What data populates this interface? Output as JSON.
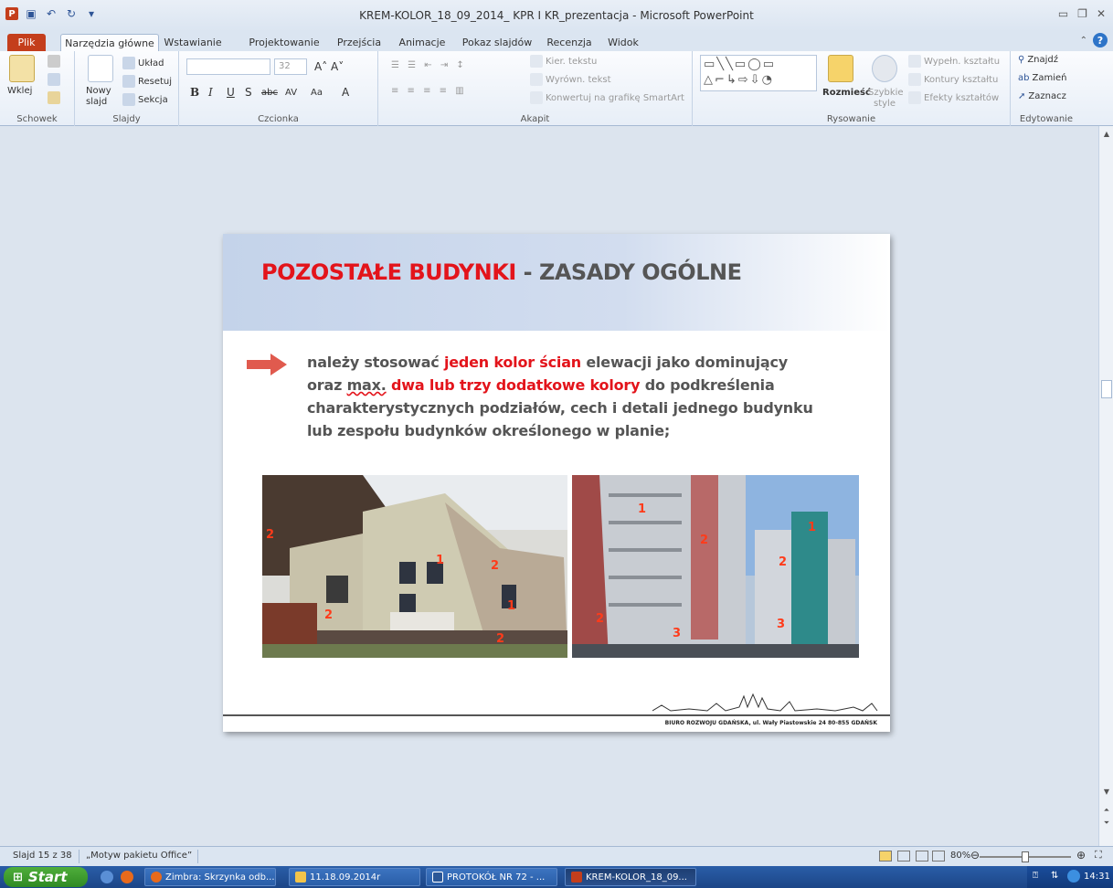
{
  "window": {
    "title": "KREM-KOLOR_18_09_2014_ KPR I KR_prezentacja  -  Microsoft PowerPoint"
  },
  "tabs": [
    "Plik",
    "Narzędzia główne",
    "Wstawianie",
    "Projektowanie",
    "Przejścia",
    "Animacje",
    "Pokaz slajdów",
    "Recenzja",
    "Widok"
  ],
  "ribbon": {
    "schowek": {
      "label": "Schowek",
      "paste": "Wklej"
    },
    "slajdy": {
      "label": "Slajdy",
      "new_slide_1": "Nowy",
      "new_slide_2": "slajd",
      "layout": "Układ",
      "reset": "Resetuj",
      "section": "Sekcja"
    },
    "czcionka": {
      "label": "Czcionka",
      "size": "32",
      "bold": "B",
      "italic": "I",
      "underline": "U",
      "shadow": "S",
      "strike": "abc",
      "spacing": "AV",
      "case": "Aa",
      "color": "A"
    },
    "akapit": {
      "label": "Akapit",
      "text_dir": "Kier. tekstu",
      "align_text": "Wyrówn. tekst",
      "smartart": "Konwertuj na grafikę SmartArt"
    },
    "rysowanie": {
      "label": "Rysowanie",
      "arrange": "Rozmieść",
      "quick_styles_1": "Szybkie",
      "quick_styles_2": "style",
      "fill": "Wypełn. kształtu",
      "outline": "Kontury kształtu",
      "effects": "Efekty kształtów"
    },
    "edytowanie": {
      "label": "Edytowanie",
      "find": "Znajdź",
      "replace": "Zamień",
      "select": "Zaznacz"
    }
  },
  "slide": {
    "title_red": "POZOSTAŁE BUDYNKI",
    "title_gray": " - ZASADY OGÓLNE",
    "bullet": {
      "p1": "należy stosować ",
      "r1": "jeden kolor ścian",
      "p2": " elewacji jako dominujący",
      "p3": "oraz ",
      "u1": "max.",
      "p4": " ",
      "r2": "dwa lub trzy dodatkowe kolory",
      "p5": " do podkreślenia",
      "p6": "charakterystycznych podziałów, cech i detali jednego budynku",
      "p7": "lub zespołu budynków określonego w planie;"
    },
    "badges": [
      "2",
      "1",
      "2",
      "2",
      "1",
      "2",
      "1",
      "2",
      "2",
      "1",
      "2",
      "3",
      "3"
    ],
    "footer": "BIURO ROZWOJU GDAŃSKA, ul. Wały Piastowskie 24  80-855 GDAŃSK"
  },
  "status": {
    "slide": "Slajd 15 z 38",
    "theme": "„Motyw pakietu Office”",
    "zoom": "80%",
    "zoom_level": 0.5
  },
  "taskbar": {
    "start": "Start",
    "tasks": [
      "Zimbra: Skrzynka odb...",
      "11.18.09.2014r",
      "PROTOKÓŁ NR  72 - ...",
      "KREM-KOLOR_18_09..."
    ],
    "clock": "14:31"
  },
  "colors": {
    "accent_red": "#e3141b",
    "title_gray": "#555555",
    "header_blue": "#c4d3ea",
    "file_tab": "#c43e1c"
  }
}
